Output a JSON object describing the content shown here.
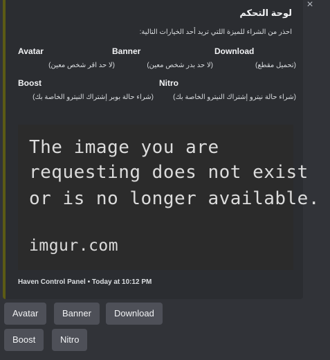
{
  "close_icon": "×",
  "embed": {
    "accent_color": "#5c5b14",
    "title": "لوحة التحكم",
    "description": "احذر من الشراء للميزة اللتي تريد أحد الخيارات التالية:",
    "fields": {
      "avatar": {
        "name": "Avatar",
        "value": "(لا حد اقر شخص معين)"
      },
      "banner": {
        "name": "Banner",
        "value": "(لا حد بدر شخص معين)"
      },
      "download": {
        "name": "Download",
        "value": "(تحميل مقطع)"
      },
      "boost": {
        "name": "Boost",
        "value": "(شراء حالة بوبر إشتراك النيترو الخاصة بك)"
      },
      "nitro": {
        "name": "Nitro",
        "value": "(شراء حالة نيترو إشتراك النيترو الخاصة بك)"
      }
    },
    "image": {
      "line1": "The image you are",
      "line2": "requesting does not exist",
      "line3": "or is no longer available.",
      "line4": "imgur.com"
    },
    "footer": "Haven Control Panel • Today at 10:12 PM"
  },
  "buttons": {
    "avatar": "Avatar",
    "banner": "Banner",
    "download": "Download",
    "boost": "Boost",
    "nitro": "Nitro"
  }
}
